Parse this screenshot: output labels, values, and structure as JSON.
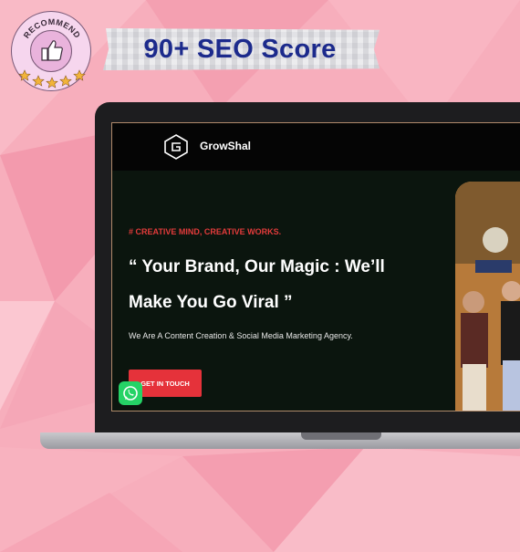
{
  "badge": {
    "text": "RECOMMEND",
    "star_count": 5
  },
  "seo_label": "90+ SEO Score",
  "site": {
    "brand": "GrowShal",
    "tagline": "# CREATIVE MIND, CREATIVE WORKS.",
    "headline_line1": "“ Your Brand, Our Magic : We’ll",
    "headline_line2": "Make You Go Viral ”",
    "subtext": "We Are A Content Creation & Social Media Marketing Agency.",
    "cta_label": "GET IN TOUCH"
  },
  "colors": {
    "background": "#f6a9b8",
    "seo_text": "#1c2a8c",
    "tagline": "#e33b3b",
    "cta": "#e5323a",
    "whatsapp": "#25d366"
  },
  "icons": [
    "thumbs-up-icon",
    "star-icon",
    "growshal-logo-icon",
    "whatsapp-icon"
  ]
}
